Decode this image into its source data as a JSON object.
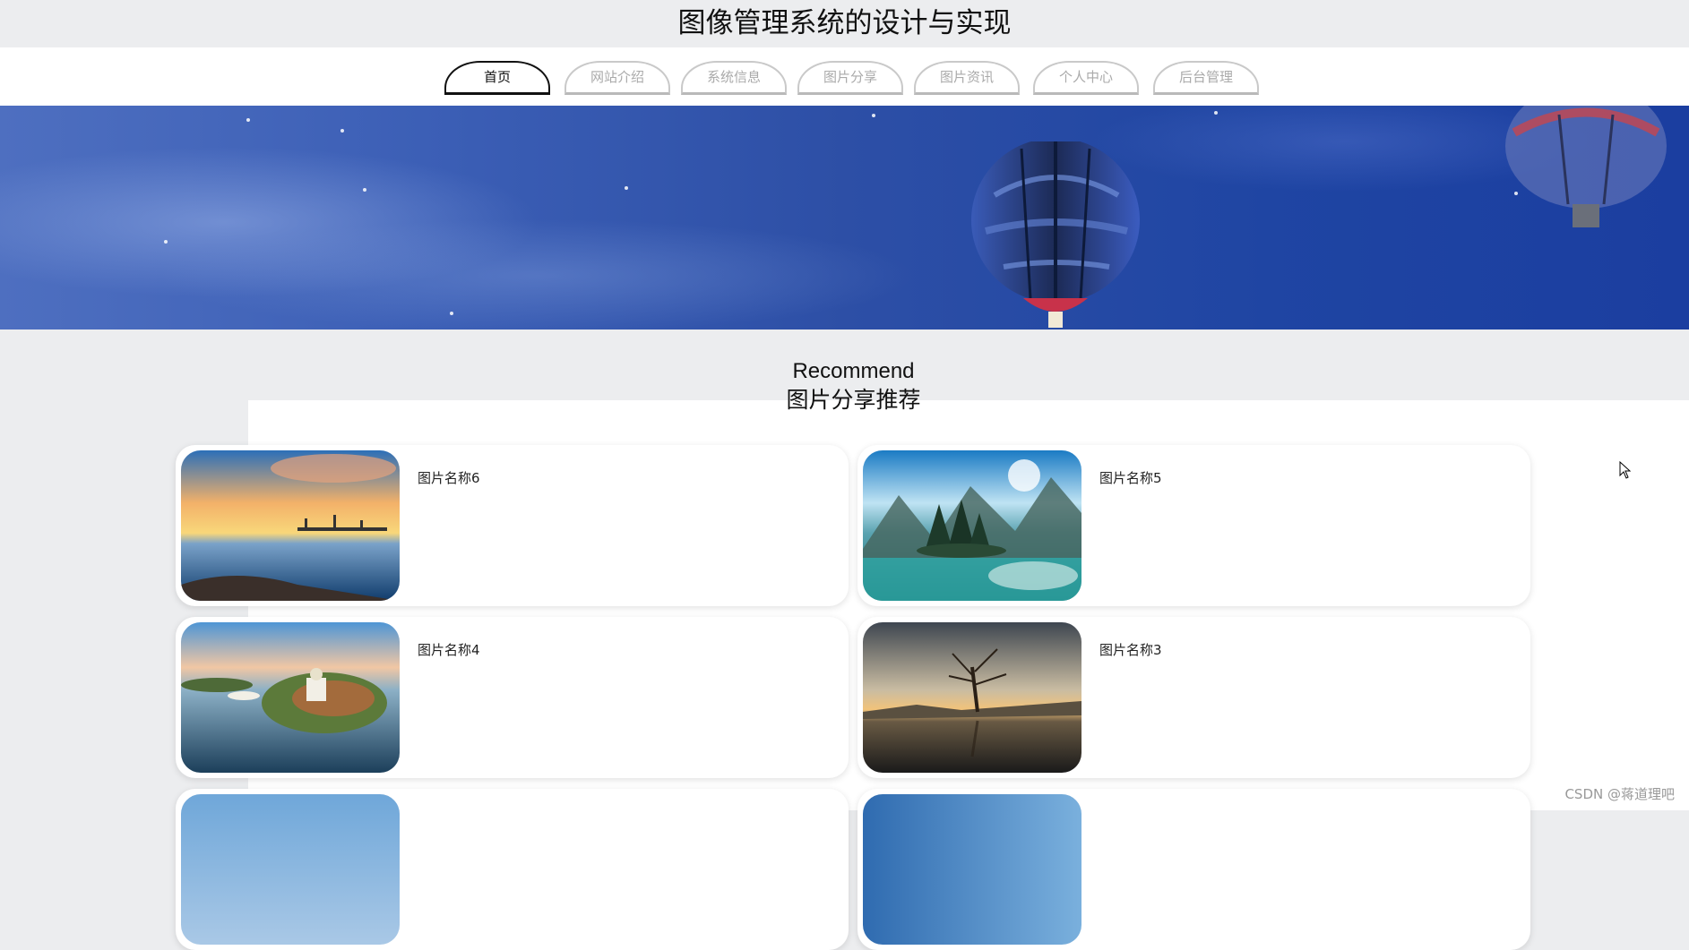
{
  "header": {
    "title": "图像管理系统的设计与实现"
  },
  "nav": {
    "tabs": [
      {
        "label": "首页",
        "active": true
      },
      {
        "label": "网站介绍",
        "active": false
      },
      {
        "label": "系统信息",
        "active": false
      },
      {
        "label": "图片分享",
        "active": false
      },
      {
        "label": "图片资讯",
        "active": false
      },
      {
        "label": "个人中心",
        "active": false
      },
      {
        "label": "后台管理",
        "active": false
      }
    ]
  },
  "recommend": {
    "title_en": "Recommend",
    "title_cn": "图片分享推荐",
    "items": [
      {
        "name": "图片名称6",
        "image": "sunset-pier-photo"
      },
      {
        "name": "图片名称5",
        "image": "mountain-lake-island-photo"
      },
      {
        "name": "图片名称4",
        "image": "aerial-church-island-photo"
      },
      {
        "name": "图片名称3",
        "image": "lone-tree-lake-photo"
      }
    ]
  },
  "watermark": "CSDN @蒋道理吧",
  "colors": {
    "page_bg": "#ecedef",
    "banner_blue": "#2d4fa6",
    "active_tab": "#111111",
    "inactive_tab": "#aaaaaa"
  }
}
